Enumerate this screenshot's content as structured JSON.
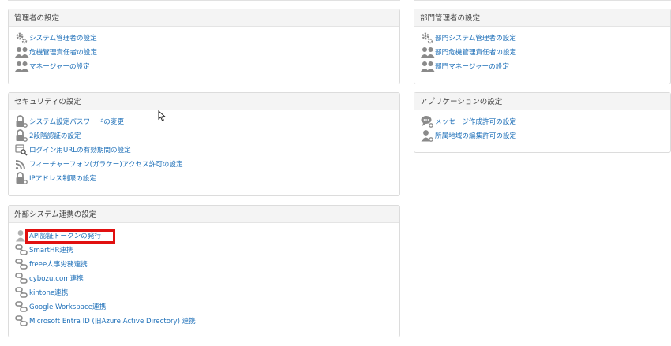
{
  "panels": {
    "admin": {
      "title": "管理者の設定",
      "items": [
        {
          "label": "システム管理者の設定",
          "icon": "gear-icon"
        },
        {
          "label": "危機管理責任者の設定",
          "icon": "users-icon"
        },
        {
          "label": "マネージャーの設定",
          "icon": "users-icon"
        }
      ]
    },
    "dept_admin": {
      "title": "部門管理者の設定",
      "items": [
        {
          "label": "部門システム管理者の設定",
          "icon": "gear-icon"
        },
        {
          "label": "部門危機管理責任者の設定",
          "icon": "users-icon"
        },
        {
          "label": "部門マネージャーの設定",
          "icon": "users-icon"
        }
      ]
    },
    "security": {
      "title": "セキュリティの設定",
      "items": [
        {
          "label": "システム設定パスワードの変更",
          "icon": "lock-gear-icon"
        },
        {
          "label": "2段階認証の設定",
          "icon": "lock-gear-icon"
        },
        {
          "label": "ログイン用URLの有効期間の設定",
          "icon": "calendar-search-icon"
        },
        {
          "label": "フィーチャーフォン(ガラケー)アクセス許可の設定",
          "icon": "signal-icon"
        },
        {
          "label": "IPアドレス制限の設定",
          "icon": "lock-gear-icon"
        }
      ]
    },
    "application": {
      "title": "アプリケーションの設定",
      "items": [
        {
          "label": "メッセージ作成許可の設定",
          "icon": "chat-gear-icon"
        },
        {
          "label": "所属地域の編集許可の設定",
          "icon": "person-gear-icon"
        }
      ]
    },
    "external": {
      "title": "外部システム連携の設定",
      "items": [
        {
          "label": "API認証トークンの発行",
          "icon": "person-icon"
        },
        {
          "label": "SmartHR連携",
          "icon": "link-icon"
        },
        {
          "label": "freee人事労務連携",
          "icon": "link-icon"
        },
        {
          "label": "cybozu.com連携",
          "icon": "link-icon"
        },
        {
          "label": "kintone連携",
          "icon": "link-icon"
        },
        {
          "label": "Google Workspace連携",
          "icon": "link-icon"
        },
        {
          "label": "Microsoft Entra ID (旧Azure Active Directory) 連携",
          "icon": "link-icon"
        }
      ]
    }
  },
  "colors": {
    "link": "#1d6fb8",
    "icon": "#8a8a8a",
    "highlight": "#e11010"
  }
}
